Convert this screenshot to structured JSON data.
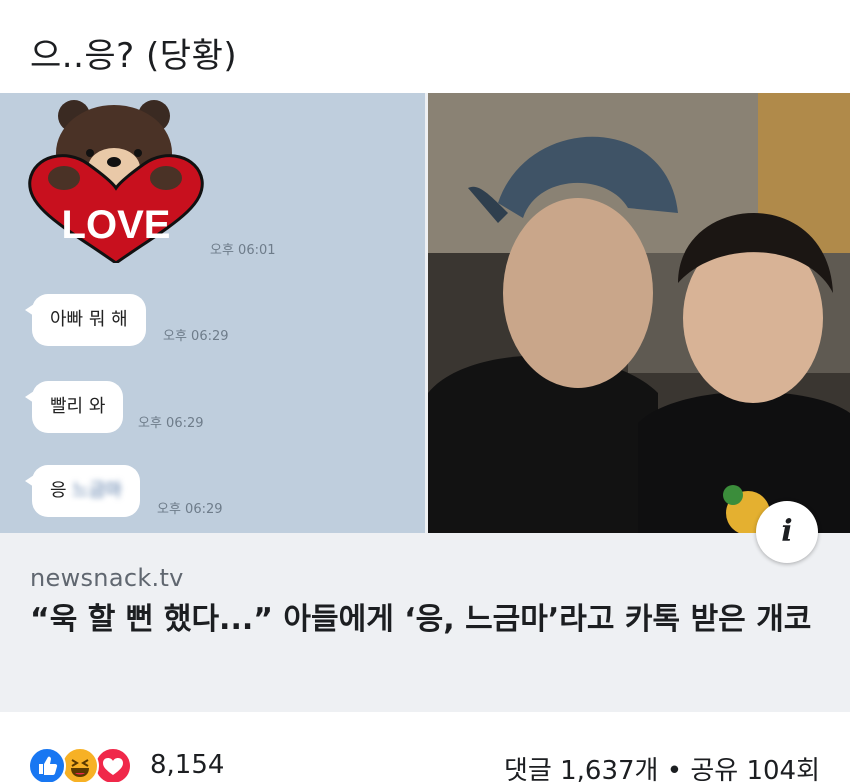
{
  "post": {
    "text": "으..응? (당황)"
  },
  "chat": {
    "sticker_text": "LOVE",
    "sticker_time": "오후 06:01",
    "messages": [
      {
        "text": "아빠 뭐 해",
        "time": "오후 06:29"
      },
      {
        "text": "빨리 와",
        "time": "오후 06:29"
      },
      {
        "text_prefix": "응",
        "text_blurred": "느금마",
        "time": "오후 06:29"
      }
    ]
  },
  "link": {
    "domain": "newsnack.tv",
    "headline": "“욱 할 뻔 했다...” 아들에게 ‘응, 느금마’라고 카톡 받은 개코",
    "info_icon": "info-icon"
  },
  "reactions": {
    "icons": [
      "like-icon",
      "haha-icon",
      "love-icon"
    ],
    "count": "8,154"
  },
  "stats": {
    "summary": "댓글 1,637개 • 공유 104회"
  },
  "colors": {
    "chat_bg": "#bfcedd",
    "like": "#1877f2",
    "haha": "#f7b125",
    "love": "#f0284a",
    "card_bg": "#eef0f3"
  }
}
